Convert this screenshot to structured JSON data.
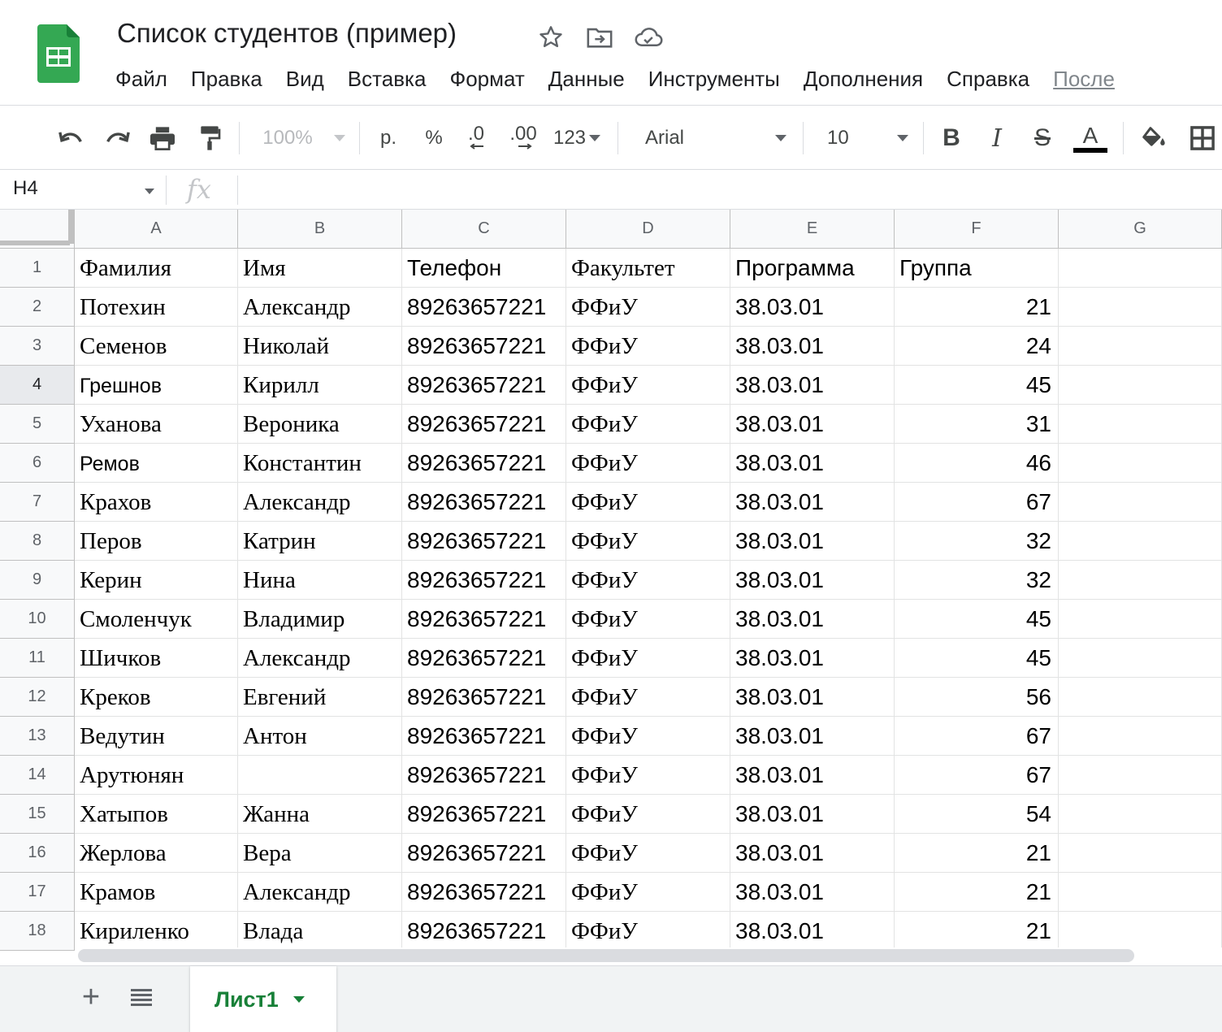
{
  "app": {
    "doc_title": "Список студентов (пример)",
    "brand_color": "#188038",
    "logo_color": "#34a853"
  },
  "menu": [
    "Файл",
    "Правка",
    "Вид",
    "Вставка",
    "Формат",
    "Данные",
    "Инструменты",
    "Дополнения",
    "Справка",
    "После"
  ],
  "toolbar": {
    "undo_icon": "undo-icon",
    "redo_icon": "redo-icon",
    "print_icon": "print-icon",
    "paint_format_icon": "paint-format-icon",
    "zoom": "100%",
    "currency": "р.",
    "percent": "%",
    "decrease_decimal": ".0",
    "increase_decimal": ".00",
    "number_format": "123",
    "font": "Arial",
    "font_size": "10",
    "bold": "B",
    "italic": "I",
    "strike": "S",
    "text_color": "A"
  },
  "formula_bar": {
    "cell_ref": "H4",
    "fx": "fx"
  },
  "grid": {
    "columns": [
      "A",
      "B",
      "C",
      "D",
      "E",
      "F",
      "G"
    ],
    "row_numbers": [
      "1",
      "2",
      "3",
      "4",
      "5",
      "6",
      "7",
      "8",
      "9",
      "10",
      "11",
      "12",
      "13",
      "14",
      "15",
      "16",
      "17",
      "18"
    ],
    "selected_row": "4",
    "rows": [
      [
        "Фамилия",
        "Имя",
        "Телефон",
        "Факультет",
        "Программа",
        "Группа"
      ],
      [
        "Потехин",
        "Александр",
        "89263657221",
        "ФФиУ",
        "38.03.01",
        "21"
      ],
      [
        "Семенов",
        "Николай",
        "89263657221",
        "ФФиУ",
        "38.03.01",
        "24"
      ],
      [
        "Грешнов",
        "Кирилл",
        "89263657221",
        "ФФиУ",
        "38.03.01",
        "45"
      ],
      [
        "Уханова",
        "Вероника",
        "89263657221",
        "ФФиУ",
        "38.03.01",
        "31"
      ],
      [
        "Ремов",
        "Константин",
        "89263657221",
        "ФФиУ",
        "38.03.01",
        "46"
      ],
      [
        "Крахов",
        "Александр",
        "89263657221",
        "ФФиУ",
        "38.03.01",
        "67"
      ],
      [
        "Перов",
        "Катрин",
        "89263657221",
        "ФФиУ",
        "38.03.01",
        "32"
      ],
      [
        "Керин",
        "Нина",
        "89263657221",
        "ФФиУ",
        "38.03.01",
        "32"
      ],
      [
        "Смоленчук",
        "Владимир",
        "89263657221",
        "ФФиУ",
        "38.03.01",
        "45"
      ],
      [
        "Шичков",
        "Александр",
        "89263657221",
        "ФФиУ",
        "38.03.01",
        "45"
      ],
      [
        "Креков",
        "Евгений",
        "89263657221",
        "ФФиУ",
        "38.03.01",
        "56"
      ],
      [
        "Ведутин",
        "Антон",
        "89263657221",
        "ФФиУ",
        "38.03.01",
        "67"
      ],
      [
        "Арутюнян",
        "",
        "89263657221",
        "ФФиУ",
        "38.03.01",
        "67"
      ],
      [
        "Хатыпов",
        "Жанна",
        "89263657221",
        "ФФиУ",
        "38.03.01",
        "54"
      ],
      [
        "Жерлова",
        "Вера",
        "89263657221",
        "ФФиУ",
        "38.03.01",
        "21"
      ],
      [
        "Крамов",
        "Александр",
        "89263657221",
        "ФФиУ",
        "38.03.01",
        "21"
      ],
      [
        "Кириленко",
        "Влада",
        "89263657221",
        "ФФиУ",
        "38.03.01",
        "21"
      ]
    ]
  },
  "sheets": {
    "active": "Лист1"
  }
}
